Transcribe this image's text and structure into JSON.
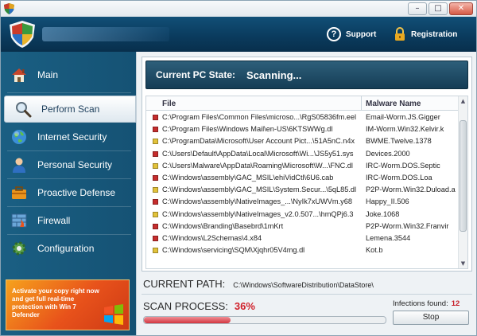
{
  "window": {
    "minimize_glyph": "–",
    "maximize_glyph": "□",
    "close_glyph": "✕"
  },
  "header": {
    "support_label": "Support",
    "registration_label": "Registration"
  },
  "sidebar": {
    "items": [
      {
        "label": "Main",
        "icon": "home-icon"
      },
      {
        "label": "Perform Scan",
        "icon": "magnifier-icon"
      },
      {
        "label": "Internet Security",
        "icon": "globe-icon"
      },
      {
        "label": "Personal Security",
        "icon": "user-icon"
      },
      {
        "label": "Proactive Defense",
        "icon": "toolbox-icon"
      },
      {
        "label": "Firewall",
        "icon": "firewall-icon"
      },
      {
        "label": "Configuration",
        "icon": "gear-icon"
      }
    ],
    "active_index": 1,
    "promo_text": "Activate your copy right now and get full real-time protection with Win 7 Defender"
  },
  "state": {
    "label": "Current PC State:",
    "value": "Scanning..."
  },
  "table": {
    "columns": [
      "File",
      "Malware Name"
    ],
    "rows": [
      {
        "path": "C:\\Program Files\\Common Files\\microso...\\RgS05836fm.eel",
        "malware": "Email-Worm.JS.Gigger",
        "color": "#c62d2d"
      },
      {
        "path": "C:\\Program Files\\Windows Mail\\en-US\\6KTSWWg.dl",
        "malware": "IM-Worm.Win32.Kelvir.k",
        "color": "#c62d2d"
      },
      {
        "path": "C:\\ProgramData\\Microsoft\\User Account Pict...\\51A5nC.n4x",
        "malware": "BWME.Twelve.1378",
        "color": "#e2c23a"
      },
      {
        "path": "C:\\Users\\Default\\AppData\\Local\\Microsoft\\Wi...\\JS5y51.sys",
        "malware": "Devices.2000",
        "color": "#c62d2d"
      },
      {
        "path": "C:\\Users\\Malware\\AppData\\Roaming\\Microsoft\\W...\\FNC.dl",
        "malware": "IRC-Worm.DOS.Septic",
        "color": "#e2c23a"
      },
      {
        "path": "C:\\Windows\\assembly\\GAC_MSIL\\ehiVidCtl\\6U6.cab",
        "malware": "IRC-Worm.DOS.Loa",
        "color": "#c62d2d"
      },
      {
        "path": "C:\\Windows\\assembly\\GAC_MSIL\\System.Secur...\\5qL85.dl",
        "malware": "P2P-Worm.Win32.Duload.a",
        "color": "#e2c23a"
      },
      {
        "path": "C:\\Windows\\assembly\\NativeImages_...\\NyIk7xUWVm.y68",
        "malware": "Happy_II.506",
        "color": "#c62d2d"
      },
      {
        "path": "C:\\Windows\\assembly\\NativeImages_v2.0.507...\\hmQPj6.3",
        "malware": "Joke.1068",
        "color": "#e2c23a"
      },
      {
        "path": "C:\\Windows\\Branding\\Basebrd\\1mKrt",
        "malware": "P2P-Worm.Win32.Franvir",
        "color": "#c62d2d"
      },
      {
        "path": "C:\\Windows\\L2Schemas\\4.x84",
        "malware": "Lemena.3544",
        "color": "#c62d2d"
      },
      {
        "path": "C:\\Windows\\servicing\\SQM\\Xjqhr05V4mg.dl",
        "malware": "Kot.b",
        "color": "#e2c23a"
      }
    ]
  },
  "current_path": {
    "label": "CURRENT PATH:",
    "value": "C:\\Windows\\SoftwareDistribution\\DataStore\\"
  },
  "scan": {
    "label": "SCAN PROCESS:",
    "percent_text": "36%",
    "progress_fraction": 0.36,
    "infections_label": "Infections found:",
    "infections_count": "12",
    "stop_label": "Stop"
  }
}
